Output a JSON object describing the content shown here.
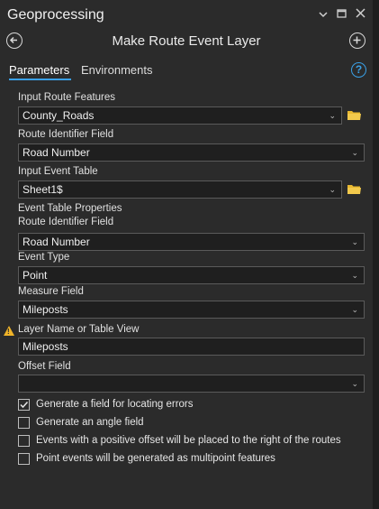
{
  "window": {
    "title": "Geoprocessing",
    "menu_icon": "chevron-down-icon",
    "maximize_icon": "maximize-icon",
    "close_icon": "close-icon"
  },
  "tool": {
    "title": "Make Route Event Layer",
    "back_icon": "back-arrow-icon",
    "add_icon": "add-icon"
  },
  "tabs": [
    {
      "label": "Parameters",
      "active": true
    },
    {
      "label": "Environments",
      "active": false
    }
  ],
  "help_icon": "help-icon",
  "params": {
    "input_route_features": {
      "label": "Input Route Features",
      "value": "County_Roads"
    },
    "route_identifier_field": {
      "label": "Route Identifier Field",
      "value": "Road Number"
    },
    "input_event_table": {
      "label": "Input Event Table",
      "value": "Sheet1$"
    },
    "event_table_properties": {
      "label": "Event Table Properties"
    },
    "event_route_identifier_field": {
      "label": "Route Identifier Field",
      "value": "Road Number"
    },
    "event_type": {
      "label": "Event Type",
      "value": "Point"
    },
    "measure_field": {
      "label": "Measure Field",
      "value": "Mileposts"
    },
    "layer_name": {
      "label": "Layer Name or Table View",
      "value": "Mileposts",
      "warning_icon": "warning-icon"
    },
    "offset_field": {
      "label": "Offset Field",
      "value": ""
    }
  },
  "checkboxes": [
    {
      "label": "Generate a field for locating errors",
      "checked": true
    },
    {
      "label": "Generate an angle field",
      "checked": false
    },
    {
      "label": "Events with a positive offset will be placed to the right of the routes",
      "checked": false
    },
    {
      "label": "Point events will be generated as multipoint features",
      "checked": false
    }
  ],
  "colors": {
    "background": "#2b2b2b",
    "field_bg": "#1f1f1f",
    "accent": "#3aa0e6",
    "folder": "#e8b830",
    "warning": "#f0b429"
  }
}
